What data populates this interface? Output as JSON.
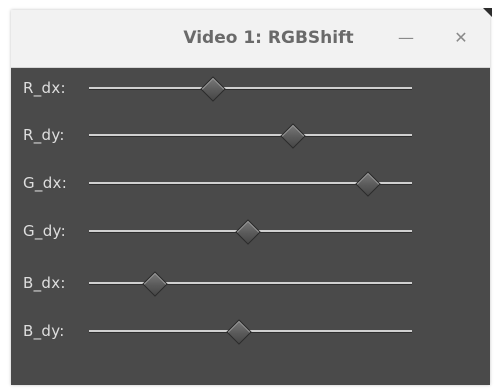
{
  "window": {
    "title": "Video 1: RGBShift",
    "minimize_glyph": "—",
    "close_glyph": "✕"
  },
  "sliders": [
    {
      "label": "R_dx:",
      "value": 0.38
    },
    {
      "label": "R_dy:",
      "value": 0.63
    },
    {
      "label": "G_dx:",
      "value": 0.86
    },
    {
      "label": "G_dy:",
      "value": 0.49
    },
    {
      "label": "B_dx:",
      "value": 0.2
    },
    {
      "label": "B_dy:",
      "value": 0.46
    }
  ]
}
